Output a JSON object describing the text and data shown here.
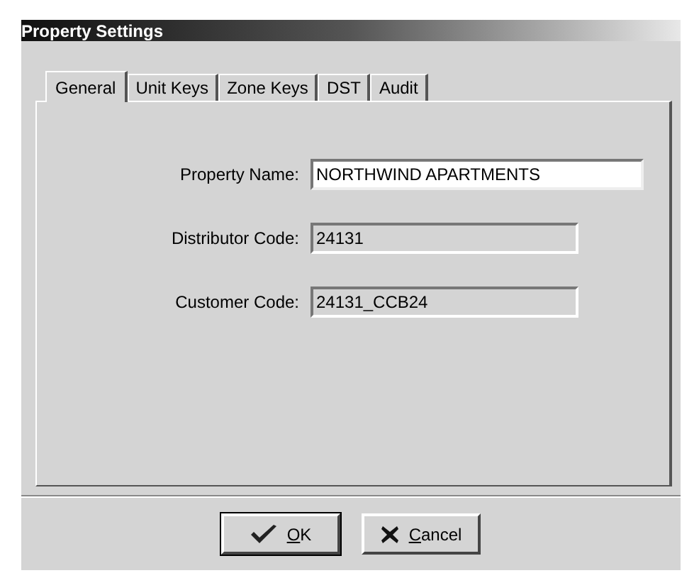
{
  "window": {
    "title": "Property Settings"
  },
  "tabs": [
    {
      "label": "General",
      "selected": true
    },
    {
      "label": "Unit Keys",
      "selected": false
    },
    {
      "label": "Zone Keys",
      "selected": false
    },
    {
      "label": "DST",
      "selected": false
    },
    {
      "label": "Audit",
      "selected": false
    }
  ],
  "fields": [
    {
      "label": "Property Name:",
      "value": "NORTHWIND APARTMENTS",
      "disabled": false
    },
    {
      "label": "Distributor Code:",
      "value": "24131",
      "disabled": true
    },
    {
      "label": "Customer Code:",
      "value": "24131_CCB24",
      "disabled": true
    }
  ],
  "buttons": [
    {
      "kind": "ok",
      "label": "OK"
    },
    {
      "kind": "cancel",
      "label": "Cancel"
    }
  ]
}
